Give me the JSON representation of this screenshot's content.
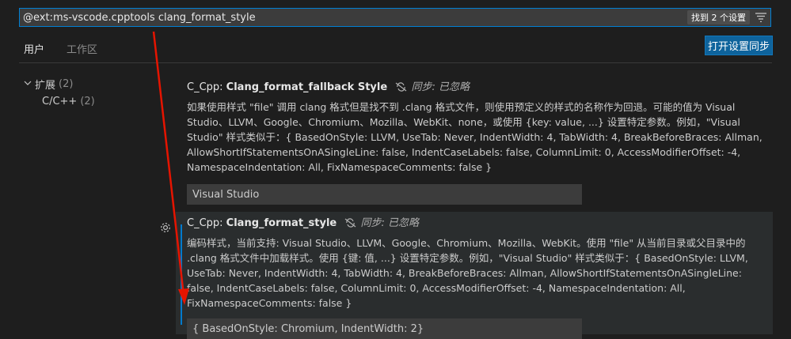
{
  "search": {
    "value": "@ext:ms-vscode.cpptools clang_format_style",
    "result_count": "找到 2 个设置"
  },
  "tabs": [
    {
      "label": "用户",
      "active": true
    },
    {
      "label": "工作区",
      "active": false
    }
  ],
  "sync_button": "打开设置同步",
  "tree": {
    "root": {
      "label": "扩展",
      "count": "(2)"
    },
    "child": {
      "label": "C/C++",
      "count": "(2)"
    }
  },
  "settings": [
    {
      "category": "C_Cpp: ",
      "name": "Clang_format_fallback Style",
      "sync_state": "同步: 已忽略",
      "description": "如果使用样式 \"file\" 调用 clang 格式但是找不到 .clang 格式文件，则使用预定义的样式的名称作为回退。可能的值为 Visual Studio、LLVM、Google、Chromium、Mozilla、WebKit、none，或使用 {key: value, ...} 设置特定参数。例如，\"Visual Studio\" 样式类似于：{ BasedOnStyle: LLVM, UseTab: Never, IndentWidth: 4, TabWidth: 4, BreakBeforeBraces: Allman, AllowShortIfStatementsOnASingleLine: false, IndentCaseLabels: false, ColumnLimit: 0, AccessModifierOffset: -4, NamespaceIndentation: All, FixNamespaceComments: false }",
      "value": "Visual Studio"
    },
    {
      "category": "C_Cpp: ",
      "name": "Clang_format_style",
      "sync_state": "同步: 已忽略",
      "description": "编码样式，当前支持: Visual Studio、LLVM、Google、Chromium、Mozilla、WebKit。使用 \"file\" 从当前目录或父目录中的 .clang 格式文件中加载样式。使用 {键: 值, ...} 设置特定参数。例如，\"Visual Studio\" 样式类似于：{ BasedOnStyle: LLVM, UseTab: Never, IndentWidth: 4, TabWidth: 4, BreakBeforeBraces: Allman, AllowShortIfStatementsOnASingleLine: false, IndentCaseLabels: false, ColumnLimit: 0, AccessModifierOffset: -4, NamespaceIndentation: All, FixNamespaceComments: false }",
      "value": "{ BasedOnStyle: Chromium, IndentWidth: 2}"
    }
  ],
  "colors": {
    "accent": "#007acc",
    "button": "#0e639c",
    "annotation": "#e51400"
  }
}
